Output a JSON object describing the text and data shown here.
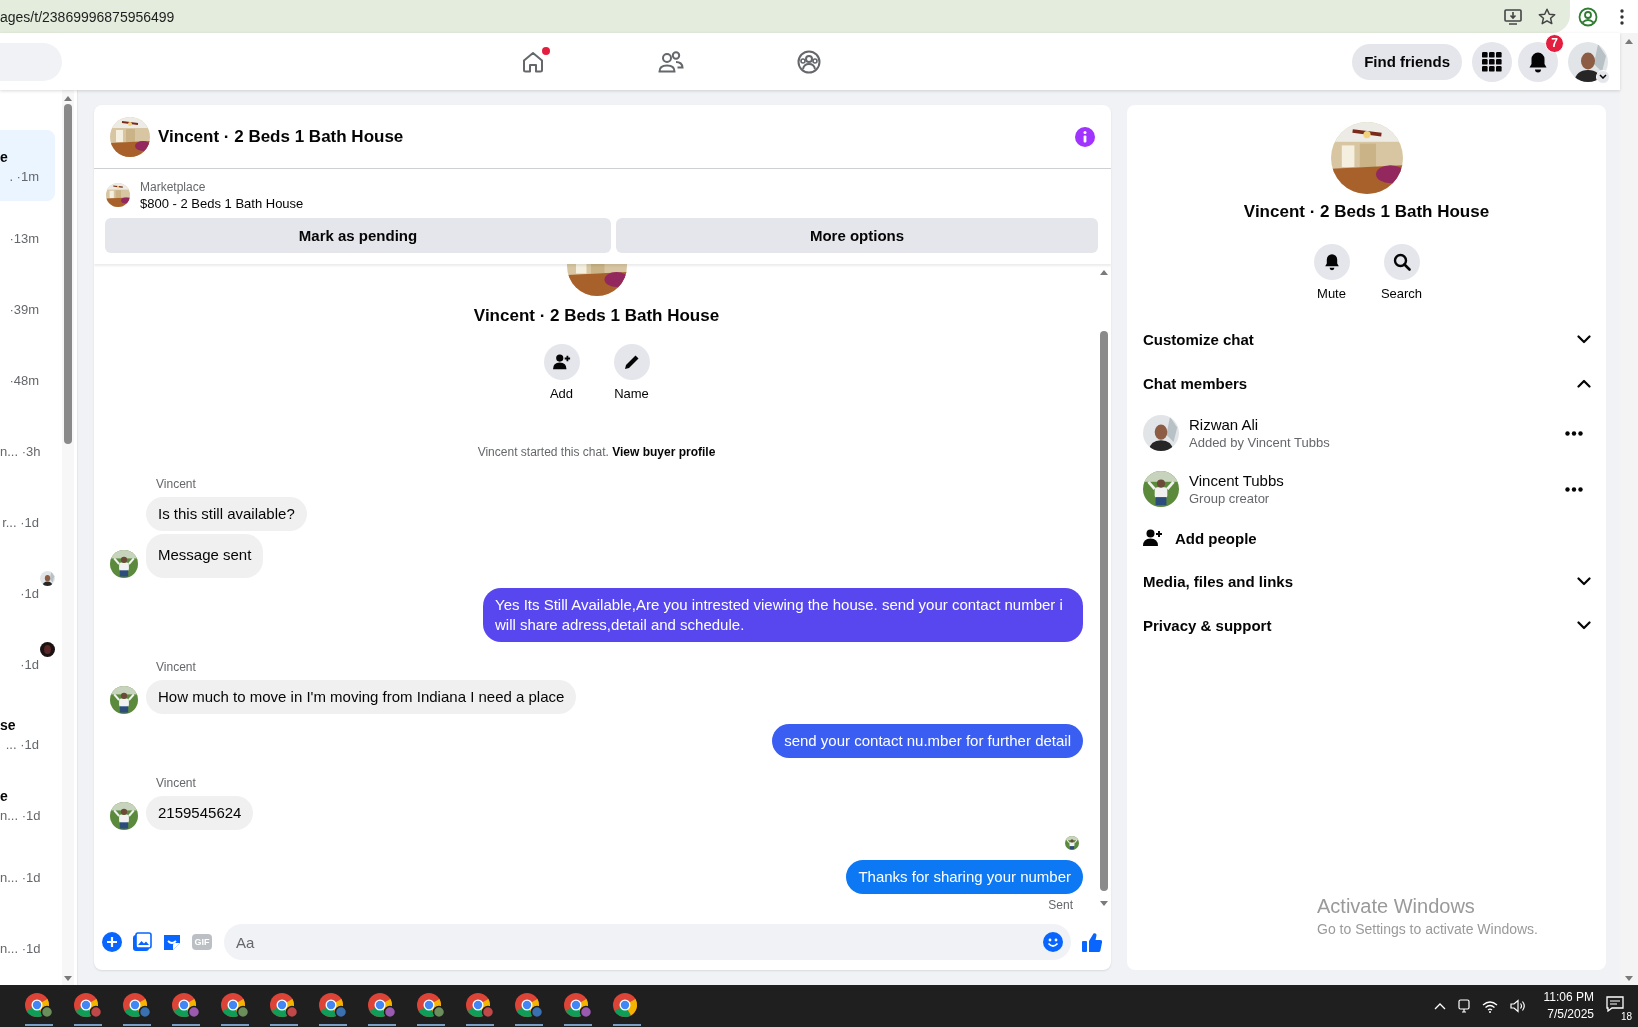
{
  "browser": {
    "url": "ages/t/23869996875956499"
  },
  "topnav": {
    "home_dot": true,
    "find_friends": "Find friends",
    "notification_count": "7"
  },
  "conversations": [
    {
      "title": "e",
      "preview": ".",
      "time": "·1m",
      "selected": true,
      "seen_avatar": false
    },
    {
      "time": "·13m",
      "selected": false,
      "seen_avatar": false
    },
    {
      "time": "·39m",
      "selected": false,
      "seen_avatar": false
    },
    {
      "time": "·48m",
      "selected": false,
      "seen_avatar": false
    },
    {
      "preview": "n...",
      "time": "·3h",
      "selected": false,
      "seen_avatar": false
    },
    {
      "preview": "r...",
      "time": "·1d",
      "selected": false,
      "seen_avatar": false
    },
    {
      "time": "·1d",
      "selected": false,
      "seen_avatar": true
    },
    {
      "time": "·1d",
      "selected": false,
      "seen_avatar": true
    },
    {
      "title": "se",
      "preview": "...",
      "time": "·1d",
      "selected": false,
      "seen_avatar": false
    },
    {
      "title": "e",
      "preview": "n...",
      "time": "·1d",
      "selected": false,
      "seen_avatar": false
    },
    {
      "preview": "n...",
      "time": "·1d",
      "selected": false,
      "seen_avatar": false
    },
    {
      "preview": "n...",
      "time": "·1d",
      "selected": false,
      "seen_avatar": false
    }
  ],
  "chat": {
    "title": "Vincent · 2 Beds 1 Bath House",
    "listing": {
      "label": "Marketplace",
      "text": "$800 - 2 Beds 1 Bath House"
    },
    "buttons": [
      "Mark as pending",
      "More options"
    ],
    "intro": {
      "title": "Vincent · 2 Beds 1 Bath House",
      "actions": [
        "Add",
        "Name"
      ],
      "note": "Vincent started this chat.",
      "note_link": "View buyer profile"
    },
    "messages": [
      {
        "kind": "incoming",
        "sender": "Vincent",
        "text": "Is this still available?",
        "avatar": false
      },
      {
        "kind": "incoming",
        "text": "Message sent",
        "avatar": true
      },
      {
        "kind": "outgoing",
        "text": "Yes Its Still Available,Are you intrested viewing the house. send your contact number i will share adress,detail and schedule.",
        "color": "#5847ee"
      },
      {
        "kind": "incoming",
        "sender": "Vincent",
        "text": "How much to move in I'm moving from Indiana I need a place",
        "avatar": true
      },
      {
        "kind": "outgoing",
        "text": "send your contact nu.mber for further detail",
        "color": "#3a5ef2"
      },
      {
        "kind": "incoming",
        "sender": "Vincent",
        "text": "2159545624",
        "avatar": true
      },
      {
        "kind": "seen"
      },
      {
        "kind": "outgoing",
        "text": "Thanks for sharing your number",
        "color": "#0c78f4",
        "status": "Sent"
      }
    ],
    "composer": {
      "gif": "GIF",
      "placeholder": "Aa"
    }
  },
  "details": {
    "title": "Vincent · 2 Beds 1 Bath House",
    "actions": [
      "Mute",
      "Search"
    ],
    "sections": [
      {
        "label": "Customize chat",
        "expanded": false
      },
      {
        "label": "Chat members",
        "expanded": true,
        "members": [
          {
            "name": "Rizwan Ali",
            "subtitle": "Added by Vincent Tubbs"
          },
          {
            "name": "Vincent Tubbs",
            "subtitle": "Group creator"
          }
        ],
        "add_label": "Add people"
      },
      {
        "label": "Media, files and links",
        "expanded": false
      },
      {
        "label": "Privacy & support",
        "expanded": false
      }
    ]
  },
  "os_overlay": {
    "title": "Activate Windows",
    "text": "Go to Settings to activate Windows."
  },
  "taskbar": {
    "apps": [
      {
        "running": true
      },
      {
        "running": true
      },
      {
        "running": true
      },
      {
        "running": true
      },
      {
        "running": true
      },
      {
        "running": true
      },
      {
        "running": true
      },
      {
        "running": true
      },
      {
        "running": true
      },
      {
        "running": true
      },
      {
        "running": true
      },
      {
        "running": true
      },
      {
        "running": true
      }
    ],
    "time": "11:06 PM",
    "date": "7/5/2025",
    "notification_count": "18"
  }
}
